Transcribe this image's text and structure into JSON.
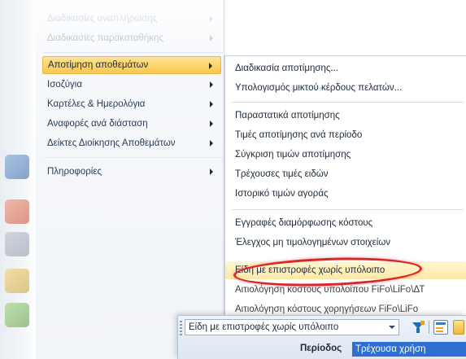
{
  "menu_level1": {
    "items": [
      {
        "label": "Διαδικασίες αναπλήρωσης",
        "faded": true,
        "has_submenu": true
      },
      {
        "label": "Διαδικασίες παρακαταθήκης",
        "faded": true,
        "has_submenu": true
      },
      {
        "label": "Αποτίμηση αποθεμάτων",
        "active": true,
        "has_submenu": true
      },
      {
        "label": "Ισοζύγια",
        "has_submenu": true
      },
      {
        "label": "Καρτέλες & Ημερολόγια",
        "has_submenu": true
      },
      {
        "label": "Αναφορές ανά διάσταση",
        "has_submenu": true
      },
      {
        "label": "Δείκτες Διοίκησης Αποθεμάτων",
        "has_submenu": true
      },
      {
        "label": "Πληροφορίες",
        "has_submenu": true
      }
    ]
  },
  "menu_level2": {
    "items": [
      {
        "label": "Διαδικασία αποτίμησης..."
      },
      {
        "label": "Υπολογισμός μικτού κέρδους πελατών..."
      },
      {
        "label": "Παραστατικά αποτίμησης"
      },
      {
        "label": "Τιμές αποτίμησης ανά περίοδο"
      },
      {
        "label": "Σύγκριση τιμών αποτίμησης"
      },
      {
        "label": "Τρέχουσες τιμές ειδών"
      },
      {
        "label": "Ιστορικό τιμών αγοράς"
      },
      {
        "label": "Εγγραφές διαμόρφωσης κόστους"
      },
      {
        "label": "Έλεγχος μη τιμολογημένων στοιχείων"
      },
      {
        "label": "Είδη με επιστροφές χωρίς υπόλοιπο",
        "highlighted": true
      },
      {
        "label": "Αιτιολόγηση κόστους υπολοίπου FiFo\\LiFo\\ΔΤ"
      },
      {
        "label": "Αιτιολόγηση κόστους χορηγήσεων FiFo\\LiFo"
      }
    ]
  },
  "toolbar": {
    "combo_value": "Είδη με επιστροφές χωρίς υπόλοιπο",
    "period_label": "Περίοδος",
    "period_value": "Τρέχουσα χρήση",
    "icons": [
      "filter-icon",
      "form-icon",
      "edge-icon"
    ]
  },
  "colors": {
    "active_item": "#fbd46a",
    "highlight_ring": "#d8262a",
    "selection_blue": "#2f6fd3"
  }
}
